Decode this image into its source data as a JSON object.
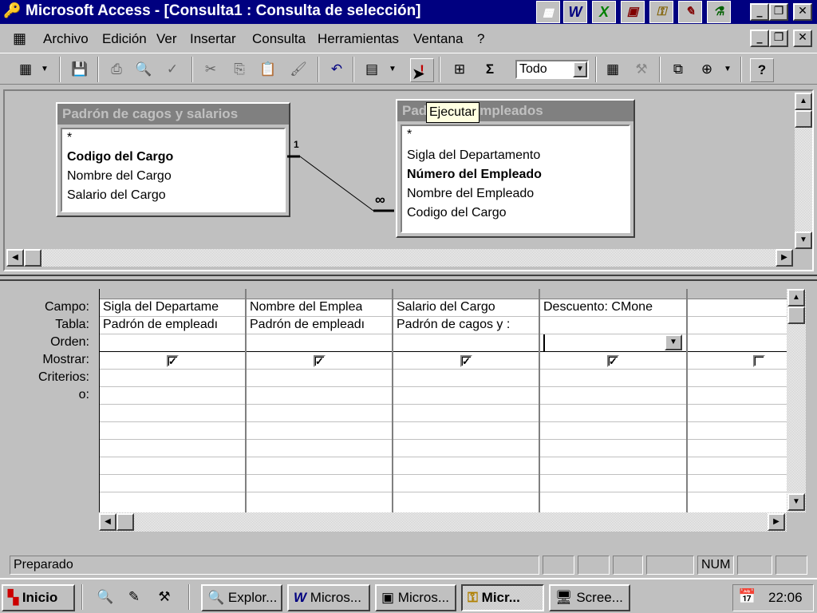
{
  "window": {
    "title": "Microsoft Access - [Consulta1 : Consulta de selección]"
  },
  "menubar": {
    "items": [
      "Archivo",
      "Edición",
      "Ver",
      "Insertar",
      "Consulta",
      "Herramientas",
      "Ventana",
      "?"
    ]
  },
  "toolbar": {
    "top_values": "Todo",
    "tooltip": "Ejecutar"
  },
  "tables": [
    {
      "title": "Padrón de cagos y salarios",
      "fields": [
        "*",
        "Codigo del Cargo",
        "Nombre del Cargo",
        "Salario del Cargo"
      ]
    },
    {
      "title": "Padrón de empleados",
      "fields": [
        "*",
        "Sigla del Departamento",
        "Número del Empleado",
        "Nombre del Empleado",
        "Codigo del Cargo"
      ]
    }
  ],
  "relationship": {
    "one_side": "1",
    "many_side": "∞"
  },
  "grid": {
    "row_labels": [
      "Campo:",
      "Tabla:",
      "Orden:",
      "Mostrar:",
      "Criterios:",
      "o:"
    ],
    "columns": [
      {
        "campo": "Sigla del Departame",
        "tabla": "Padrón de empleadı",
        "mostrar": true
      },
      {
        "campo": "Nombre del Emplea",
        "tabla": "Padrón de empleadı",
        "mostrar": true
      },
      {
        "campo": "Salario del Cargo",
        "tabla": "Padrón de cagos y :",
        "mostrar": true
      },
      {
        "campo": "Descuento: CMone",
        "tabla": "",
        "mostrar": true
      },
      {
        "campo": "",
        "tabla": "",
        "mostrar": false
      }
    ]
  },
  "statusbar": {
    "text": "Preparado",
    "num": "NUM"
  },
  "taskbar": {
    "start": "Inicio",
    "buttons": [
      "Explor...",
      "Micros...",
      "Micros...",
      "Micr...",
      "Scree..."
    ],
    "clock": "22:06"
  }
}
